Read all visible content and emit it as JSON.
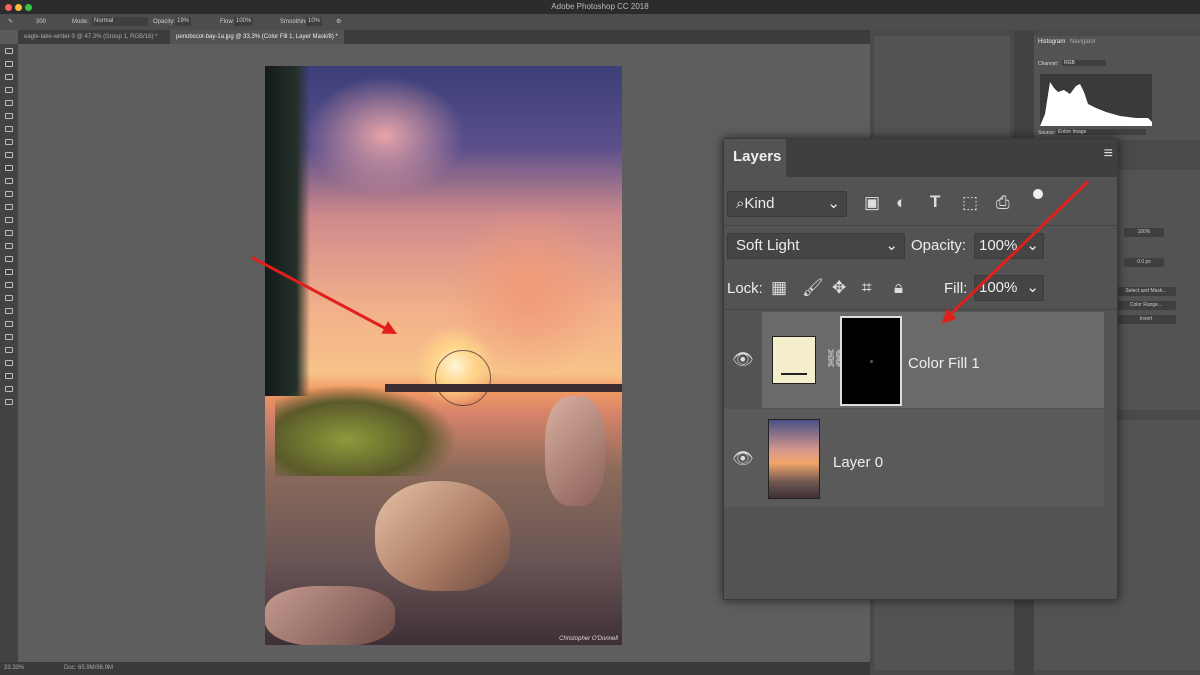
{
  "window": {
    "title": "Adobe Photoshop CC 2018"
  },
  "options_bar": {
    "brush_size": "300",
    "mode_label": "Mode:",
    "mode_value": "Normal",
    "opacity_label": "Opacity:",
    "opacity_value": "19%",
    "flow_label": "Flow:",
    "flow_value": "100%",
    "smoothing_label": "Smoothing:",
    "smoothing_value": "10%"
  },
  "tabs": [
    {
      "label": "eagle-lake-winter-3 @ 47.3% (Group 1, RGB/16) *",
      "active": false
    },
    {
      "label": "penobscot-bay-1a.jpg @ 33.3% (Color Fill 1, Layer Mask/8) *",
      "active": true
    }
  ],
  "status": {
    "zoom": "33.33%",
    "doc": "Doc: 65.9M/98.9M"
  },
  "photo": {
    "signature": "Christopher O'Donnell"
  },
  "histogram_panel": {
    "tabs": [
      "Histogram",
      "Navigator"
    ],
    "channel_label": "Channel:",
    "channel_value": "RGB",
    "source_label": "Source:",
    "source_value": "Entire Image"
  },
  "properties_panel": {
    "density": "100%",
    "feather": "0.0 px",
    "buttons": [
      "Select and Mask...",
      "Color Range...",
      "Invert"
    ]
  },
  "layers_panel": {
    "title": "Layers",
    "filter_kind": "Kind",
    "blend_mode": "Soft Light",
    "opacity_label": "Opacity:",
    "opacity_value": "100%",
    "lock_label": "Lock:",
    "fill_label": "Fill:",
    "fill_value": "100%",
    "layers": [
      {
        "name": "Color Fill 1",
        "selected": true,
        "fill_color": "#f6efcc",
        "mask_color": "#000000"
      },
      {
        "name": "Layer 0",
        "selected": false
      }
    ]
  },
  "colors": {
    "accent_arrow": "#e0201a",
    "panel": "#535353",
    "canvas": "#5e5e5e"
  }
}
